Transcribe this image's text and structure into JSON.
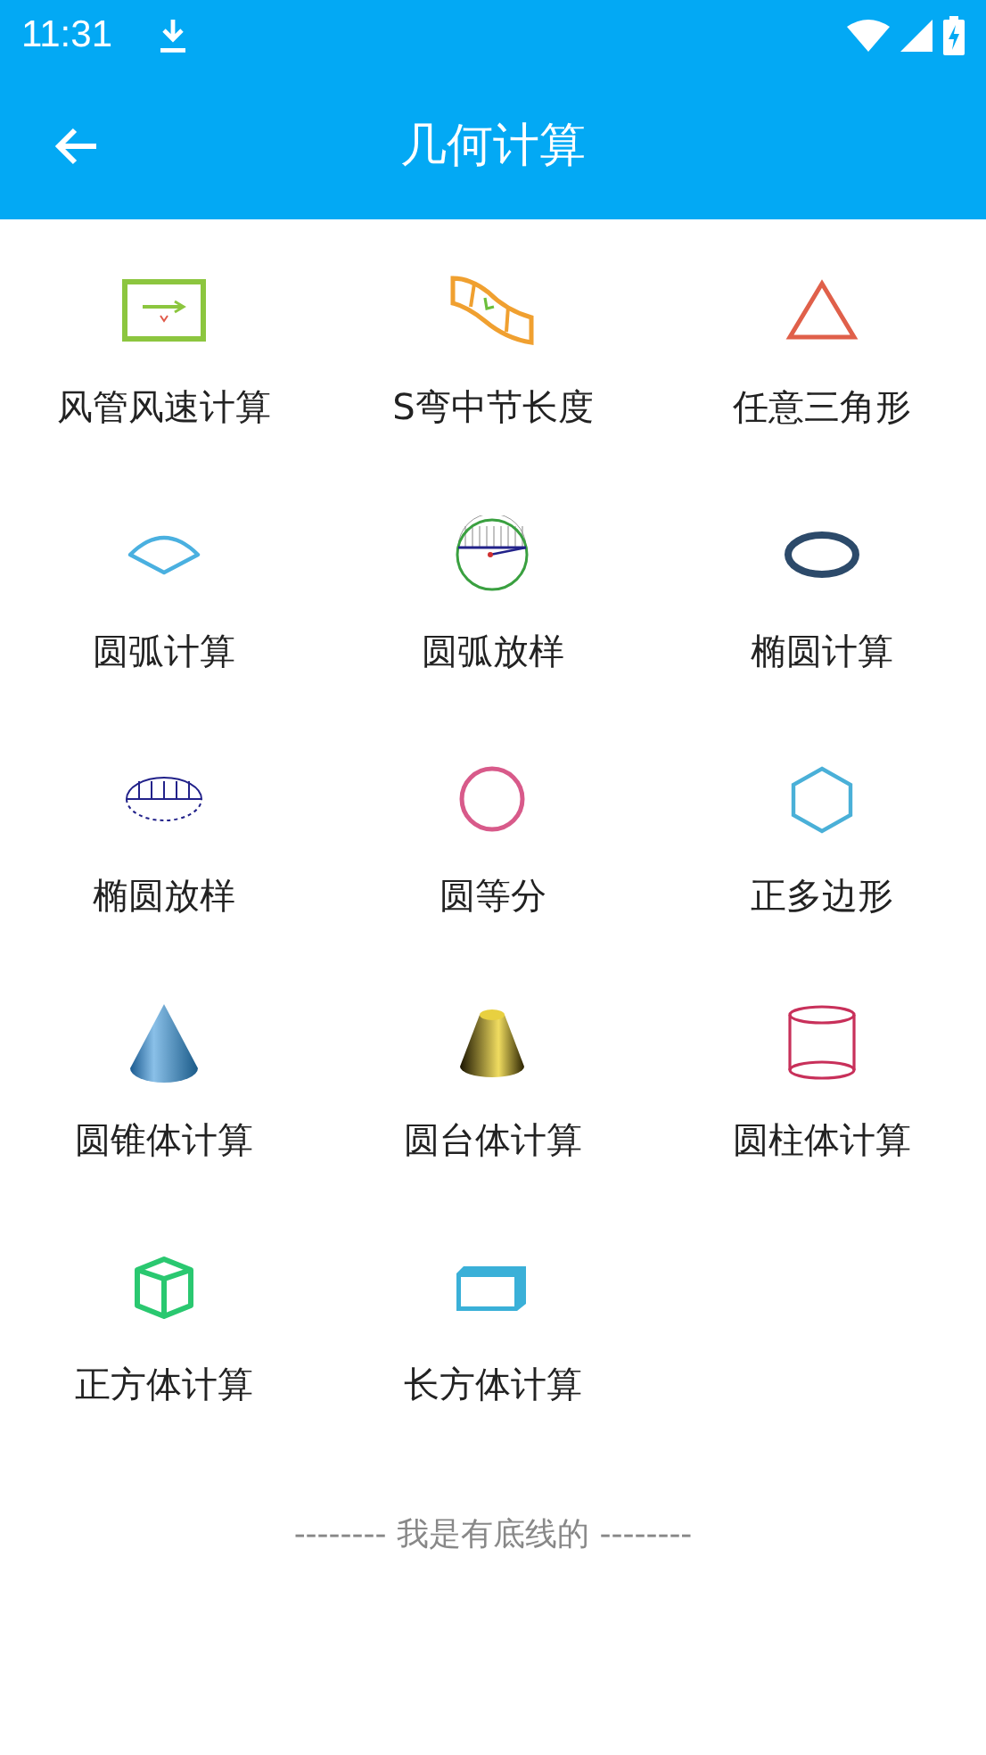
{
  "status_bar": {
    "time": "11:31"
  },
  "app_bar": {
    "title": "几何计算"
  },
  "items": [
    {
      "label": "风管风速计算",
      "kind": "duct"
    },
    {
      "label": "S弯中节长度",
      "kind": "sbend"
    },
    {
      "label": "任意三角形",
      "kind": "triangle"
    },
    {
      "label": "圆弧计算",
      "kind": "sector"
    },
    {
      "label": "圆弧放样",
      "kind": "arcloft"
    },
    {
      "label": "椭圆计算",
      "kind": "ellipse"
    },
    {
      "label": "椭圆放样",
      "kind": "ellipseloft"
    },
    {
      "label": "圆等分",
      "kind": "circle"
    },
    {
      "label": "正多边形",
      "kind": "hexagon"
    },
    {
      "label": "圆锥体计算",
      "kind": "cone"
    },
    {
      "label": "圆台体计算",
      "kind": "frustum"
    },
    {
      "label": "圆柱体计算",
      "kind": "cylinder"
    },
    {
      "label": "正方体计算",
      "kind": "cube"
    },
    {
      "label": "长方体计算",
      "kind": "cuboid"
    }
  ],
  "footer": "-------- 我是有底线的 --------"
}
